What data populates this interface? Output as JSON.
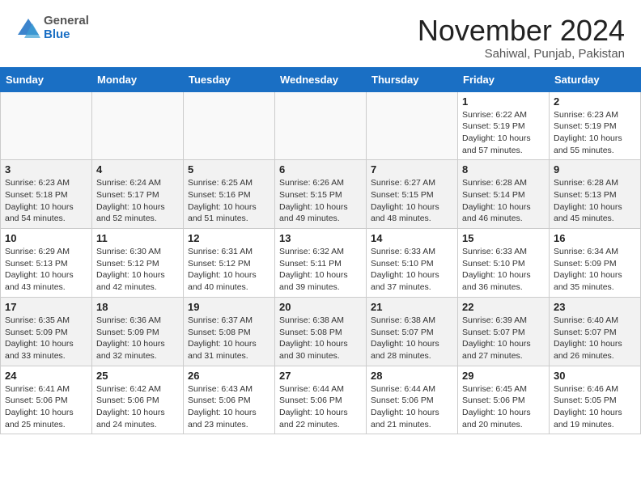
{
  "header": {
    "logo_general": "General",
    "logo_blue": "Blue",
    "month_title": "November 2024",
    "location": "Sahiwal, Punjab, Pakistan"
  },
  "days_of_week": [
    "Sunday",
    "Monday",
    "Tuesday",
    "Wednesday",
    "Thursday",
    "Friday",
    "Saturday"
  ],
  "weeks": [
    [
      {
        "num": "",
        "info": ""
      },
      {
        "num": "",
        "info": ""
      },
      {
        "num": "",
        "info": ""
      },
      {
        "num": "",
        "info": ""
      },
      {
        "num": "",
        "info": ""
      },
      {
        "num": "1",
        "info": "Sunrise: 6:22 AM\nSunset: 5:19 PM\nDaylight: 10 hours and 57 minutes."
      },
      {
        "num": "2",
        "info": "Sunrise: 6:23 AM\nSunset: 5:19 PM\nDaylight: 10 hours and 55 minutes."
      }
    ],
    [
      {
        "num": "3",
        "info": "Sunrise: 6:23 AM\nSunset: 5:18 PM\nDaylight: 10 hours and 54 minutes."
      },
      {
        "num": "4",
        "info": "Sunrise: 6:24 AM\nSunset: 5:17 PM\nDaylight: 10 hours and 52 minutes."
      },
      {
        "num": "5",
        "info": "Sunrise: 6:25 AM\nSunset: 5:16 PM\nDaylight: 10 hours and 51 minutes."
      },
      {
        "num": "6",
        "info": "Sunrise: 6:26 AM\nSunset: 5:15 PM\nDaylight: 10 hours and 49 minutes."
      },
      {
        "num": "7",
        "info": "Sunrise: 6:27 AM\nSunset: 5:15 PM\nDaylight: 10 hours and 48 minutes."
      },
      {
        "num": "8",
        "info": "Sunrise: 6:28 AM\nSunset: 5:14 PM\nDaylight: 10 hours and 46 minutes."
      },
      {
        "num": "9",
        "info": "Sunrise: 6:28 AM\nSunset: 5:13 PM\nDaylight: 10 hours and 45 minutes."
      }
    ],
    [
      {
        "num": "10",
        "info": "Sunrise: 6:29 AM\nSunset: 5:13 PM\nDaylight: 10 hours and 43 minutes."
      },
      {
        "num": "11",
        "info": "Sunrise: 6:30 AM\nSunset: 5:12 PM\nDaylight: 10 hours and 42 minutes."
      },
      {
        "num": "12",
        "info": "Sunrise: 6:31 AM\nSunset: 5:12 PM\nDaylight: 10 hours and 40 minutes."
      },
      {
        "num": "13",
        "info": "Sunrise: 6:32 AM\nSunset: 5:11 PM\nDaylight: 10 hours and 39 minutes."
      },
      {
        "num": "14",
        "info": "Sunrise: 6:33 AM\nSunset: 5:10 PM\nDaylight: 10 hours and 37 minutes."
      },
      {
        "num": "15",
        "info": "Sunrise: 6:33 AM\nSunset: 5:10 PM\nDaylight: 10 hours and 36 minutes."
      },
      {
        "num": "16",
        "info": "Sunrise: 6:34 AM\nSunset: 5:09 PM\nDaylight: 10 hours and 35 minutes."
      }
    ],
    [
      {
        "num": "17",
        "info": "Sunrise: 6:35 AM\nSunset: 5:09 PM\nDaylight: 10 hours and 33 minutes."
      },
      {
        "num": "18",
        "info": "Sunrise: 6:36 AM\nSunset: 5:09 PM\nDaylight: 10 hours and 32 minutes."
      },
      {
        "num": "19",
        "info": "Sunrise: 6:37 AM\nSunset: 5:08 PM\nDaylight: 10 hours and 31 minutes."
      },
      {
        "num": "20",
        "info": "Sunrise: 6:38 AM\nSunset: 5:08 PM\nDaylight: 10 hours and 30 minutes."
      },
      {
        "num": "21",
        "info": "Sunrise: 6:38 AM\nSunset: 5:07 PM\nDaylight: 10 hours and 28 minutes."
      },
      {
        "num": "22",
        "info": "Sunrise: 6:39 AM\nSunset: 5:07 PM\nDaylight: 10 hours and 27 minutes."
      },
      {
        "num": "23",
        "info": "Sunrise: 6:40 AM\nSunset: 5:07 PM\nDaylight: 10 hours and 26 minutes."
      }
    ],
    [
      {
        "num": "24",
        "info": "Sunrise: 6:41 AM\nSunset: 5:06 PM\nDaylight: 10 hours and 25 minutes."
      },
      {
        "num": "25",
        "info": "Sunrise: 6:42 AM\nSunset: 5:06 PM\nDaylight: 10 hours and 24 minutes."
      },
      {
        "num": "26",
        "info": "Sunrise: 6:43 AM\nSunset: 5:06 PM\nDaylight: 10 hours and 23 minutes."
      },
      {
        "num": "27",
        "info": "Sunrise: 6:44 AM\nSunset: 5:06 PM\nDaylight: 10 hours and 22 minutes."
      },
      {
        "num": "28",
        "info": "Sunrise: 6:44 AM\nSunset: 5:06 PM\nDaylight: 10 hours and 21 minutes."
      },
      {
        "num": "29",
        "info": "Sunrise: 6:45 AM\nSunset: 5:06 PM\nDaylight: 10 hours and 20 minutes."
      },
      {
        "num": "30",
        "info": "Sunrise: 6:46 AM\nSunset: 5:05 PM\nDaylight: 10 hours and 19 minutes."
      }
    ]
  ]
}
